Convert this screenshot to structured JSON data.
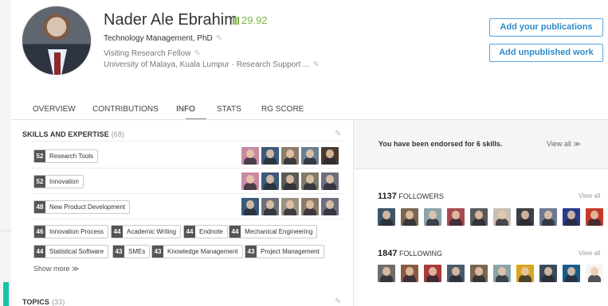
{
  "profile": {
    "name": "Nader Ale Ebrahim",
    "rg_score": "29.92",
    "degree": "Technology Management, PhD",
    "position": "Visiting Research Fellow",
    "institution": "University of Malaya, Kuala Lumpur · Research Support ..."
  },
  "actions": {
    "add_publications": "Add your publications",
    "add_unpublished": "Add unpublished work"
  },
  "tabs": [
    {
      "label": "OVERVIEW"
    },
    {
      "label": "CONTRIBUTIONS"
    },
    {
      "label": "INFO",
      "active": true
    },
    {
      "label": "STATS"
    },
    {
      "label": "RG SCORE"
    }
  ],
  "skills": {
    "title": "SKILLS AND EXPERTISE",
    "count": "(68)",
    "rows": [
      {
        "num": "52",
        "label": "Research Tools"
      },
      {
        "num": "52",
        "label": "Innovation"
      },
      {
        "num": "48",
        "label": "New Product Development"
      }
    ],
    "chips_row1": [
      {
        "num": "46",
        "label": "Innovation Process"
      },
      {
        "num": "44",
        "label": "Academic Writing"
      },
      {
        "num": "44",
        "label": "Endnote"
      },
      {
        "num": "44",
        "label": "Mechanical Engineering"
      }
    ],
    "chips_row2": [
      {
        "num": "44",
        "label": "Statistical Software"
      },
      {
        "num": "43",
        "label": "SMEs"
      },
      {
        "num": "43",
        "label": "Knowledge Management"
      },
      {
        "num": "43",
        "label": "Project Management"
      }
    ],
    "show_more": "Show more ≫"
  },
  "topics": {
    "title": "TOPICS",
    "count": "(33)"
  },
  "endorsement": {
    "text": "You have been endorsed for 6 skills.",
    "view_all": "View all ≫"
  },
  "followers": {
    "count": "1137",
    "label": "FOLLOWERS",
    "view_all": "View all"
  },
  "following": {
    "count": "1847",
    "label": "FOLLOWING",
    "view_all": "View all"
  },
  "colors": {
    "accent": "#2e8cc8",
    "score": "#7cb342",
    "badge": "#555555",
    "edge_mark": "#16c5a7"
  }
}
